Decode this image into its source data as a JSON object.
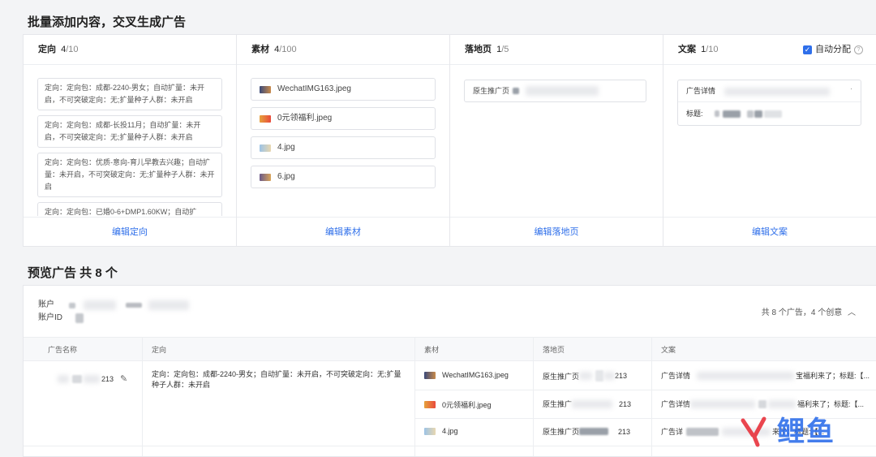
{
  "section1_title": "批量添加内容，交叉生成广告",
  "columns": {
    "targeting": {
      "label": "定向",
      "count": "4",
      "max": "/10",
      "action": "编辑定向"
    },
    "material": {
      "label": "素材",
      "count": "4",
      "max": "/100",
      "action": "编辑素材"
    },
    "landing": {
      "label": "落地页",
      "count": "1",
      "max": "/5",
      "action": "编辑落地页"
    },
    "copy": {
      "label": "文案",
      "count": "1",
      "max": "/10",
      "action": "编辑文案",
      "auto_label": "自动分配"
    }
  },
  "targeting_items": [
    "定向：定向包：成都-2240-男女；自动扩量：未开启，不可突破定向：无;扩量种子人群：未开启",
    "定向：定向包：成都-长投11月；自动扩量：未开启，不可突破定向：无;扩量种子人群：未开启",
    "定向：定向包：优质-意向-育儿早教去兴趣；自动扩量：未开启，不可突破定向：无;扩量种子人群：未开启",
    "定向：定向包：已婚0-6+DMP1.60KW；自动扩"
  ],
  "materials": [
    "WechatIMG163.jpeg",
    "0元领福利.jpeg",
    "4.jpg",
    "6.jpg"
  ],
  "landing_item": "原生推广页",
  "copy_item": {
    "name": "广告详情",
    "title_label": "标题:"
  },
  "section2_title": "预览广告 共 8 个",
  "account": {
    "label": "账户",
    "id_label": "账户ID",
    "summary": "共 8 个广告，4 个创意"
  },
  "table_headers": [
    "广告名称",
    "定向",
    "素材",
    "落地页",
    "文案"
  ],
  "row": {
    "ad_name_suffix": "213",
    "targeting": "定向：定向包：成都-2240-男女；自动扩量：未开启，不可突破定向：无;扩量种子人群：未开启"
  },
  "sub_rows": [
    {
      "material": "WechatIMG163.jpeg",
      "landing": "原生推广页",
      "landing_suffix": "213",
      "copy": "广告详情",
      "copy_tail": "宝福利来了；标题:【..."
    },
    {
      "material": "0元领福利.jpeg",
      "landing": "原生推广",
      "landing_suffix": "213",
      "copy": "广告详情",
      "copy_tail": "福利来了；标题:【..."
    },
    {
      "material": "4.jpg",
      "landing": "原生推广页",
      "landing_suffix": "213",
      "copy": "广告详",
      "copy_tail": "来了；标题:【..."
    }
  ],
  "watermark": "鲤鱼",
  "colors": {
    "accent": "#2f6fea",
    "watermark_red": "#e8323c",
    "watermark_blue": "#2f6fea"
  }
}
